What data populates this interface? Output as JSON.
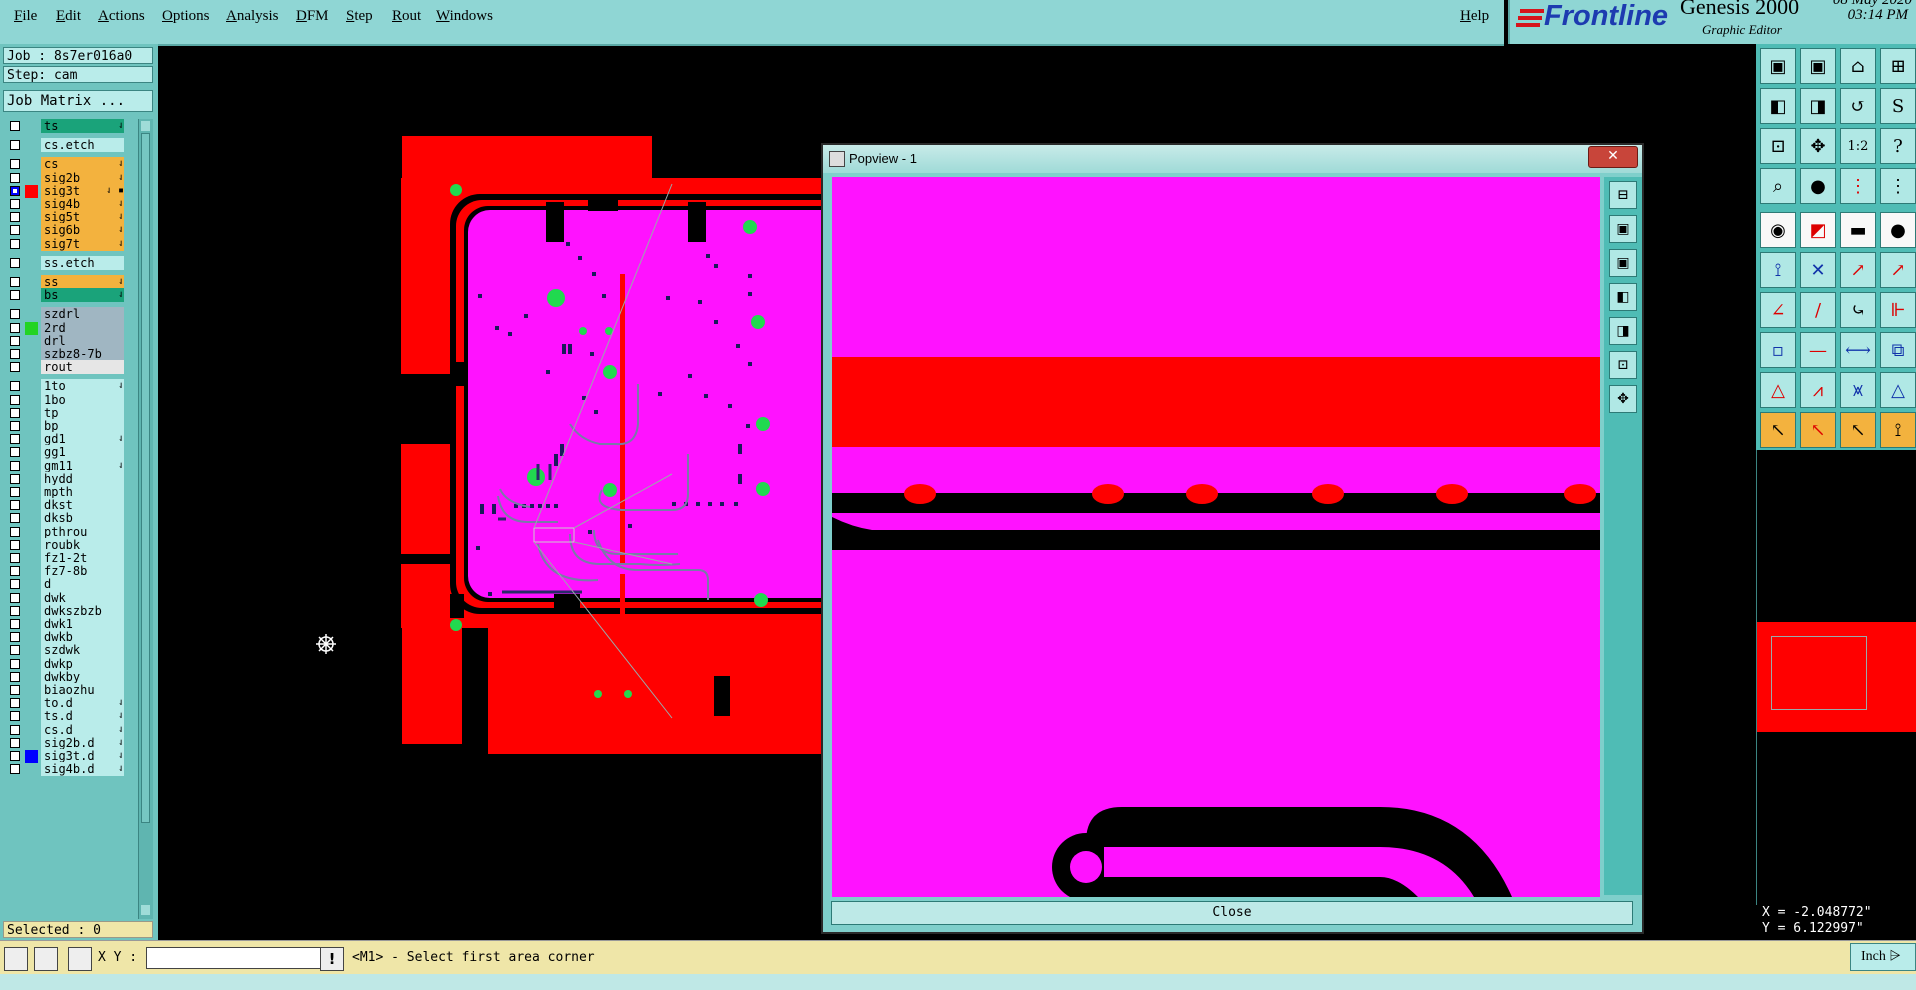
{
  "menubar": {
    "items": [
      "File",
      "Edit",
      "Actions",
      "Options",
      "Analysis",
      "DFM",
      "Step",
      "Rout",
      "Windows"
    ],
    "help": "Help"
  },
  "brand": {
    "logo": "Frontline",
    "product": "Genesis 2000",
    "subtitle": "Graphic Editor",
    "date": "08 May 2020",
    "time": "03:14 PM"
  },
  "left_panel": {
    "job": "Job : 8s7er016a0",
    "step": "Step: cam",
    "job_matrix": "Job Matrix ...",
    "selected": "Selected : 0"
  },
  "layers": [
    {
      "name": "ts",
      "color": "#1aa37a",
      "flag": "⇃"
    },
    {
      "name": "cs.etch",
      "color": "#b9ecea",
      "flag": ""
    },
    {
      "name": "cs",
      "color": "#f3b23e",
      "flag": "⇃"
    },
    {
      "name": "sig2b",
      "color": "#f3b23e",
      "flag": "⇃"
    },
    {
      "name": "sig3t",
      "color": "#f3b23e",
      "flag": "⇃ ▪",
      "mark": "#ff0000",
      "active": true
    },
    {
      "name": "sig4b",
      "color": "#f3b23e",
      "flag": "⇃"
    },
    {
      "name": "sig5t",
      "color": "#f3b23e",
      "flag": "⇃"
    },
    {
      "name": "sig6b",
      "color": "#f3b23e",
      "flag": "⇃"
    },
    {
      "name": "sig7t",
      "color": "#f3b23e",
      "flag": "⇃"
    },
    {
      "name": "ss.etch",
      "color": "#b9ecea",
      "flag": ""
    },
    {
      "name": "ss",
      "color": "#f3b23e",
      "flag": "⇃"
    },
    {
      "name": "bs",
      "color": "#1aa37a",
      "flag": "⇃"
    },
    {
      "name": "szdrl",
      "color": "#a0b6c2",
      "flag": ""
    },
    {
      "name": "2rd",
      "color": "#a0b6c2",
      "flag": "",
      "mark": "#23d423"
    },
    {
      "name": "drl",
      "color": "#a0b6c2",
      "flag": ""
    },
    {
      "name": "szbz8-7b",
      "color": "#a0b6c2",
      "flag": ""
    },
    {
      "name": "rout",
      "color": "#e6e6e6",
      "flag": ""
    },
    {
      "name": "1to",
      "color": "#b9ecea",
      "flag": "⇃"
    },
    {
      "name": "1bo",
      "color": "#b9ecea",
      "flag": ""
    },
    {
      "name": "tp",
      "color": "#b9ecea",
      "flag": ""
    },
    {
      "name": "bp",
      "color": "#b9ecea",
      "flag": ""
    },
    {
      "name": "gd1",
      "color": "#b9ecea",
      "flag": "⇃"
    },
    {
      "name": "gg1",
      "color": "#b9ecea",
      "flag": ""
    },
    {
      "name": "gm11",
      "color": "#b9ecea",
      "flag": "⇃"
    },
    {
      "name": "hydd",
      "color": "#b9ecea",
      "flag": ""
    },
    {
      "name": "mpth",
      "color": "#b9ecea",
      "flag": ""
    },
    {
      "name": "dkst",
      "color": "#b9ecea",
      "flag": ""
    },
    {
      "name": "dksb",
      "color": "#b9ecea",
      "flag": ""
    },
    {
      "name": "pthrou",
      "color": "#b9ecea",
      "flag": ""
    },
    {
      "name": "roubk",
      "color": "#b9ecea",
      "flag": ""
    },
    {
      "name": "fz1-2t",
      "color": "#b9ecea",
      "flag": ""
    },
    {
      "name": "fz7-8b",
      "color": "#b9ecea",
      "flag": ""
    },
    {
      "name": "d",
      "color": "#b9ecea",
      "flag": ""
    },
    {
      "name": "dwk",
      "color": "#b9ecea",
      "flag": ""
    },
    {
      "name": "dwkszbzb",
      "color": "#b9ecea",
      "flag": ""
    },
    {
      "name": "dwk1",
      "color": "#b9ecea",
      "flag": ""
    },
    {
      "name": "dwkb",
      "color": "#b9ecea",
      "flag": ""
    },
    {
      "name": "szdwk",
      "color": "#b9ecea",
      "flag": ""
    },
    {
      "name": "dwkp",
      "color": "#b9ecea",
      "flag": ""
    },
    {
      "name": "dwkby",
      "color": "#b9ecea",
      "flag": ""
    },
    {
      "name": "biaozhu",
      "color": "#b9ecea",
      "flag": ""
    },
    {
      "name": "to.d",
      "color": "#b9ecea",
      "flag": "⇃"
    },
    {
      "name": "ts.d",
      "color": "#b9ecea",
      "flag": "⇃"
    },
    {
      "name": "cs.d",
      "color": "#b9ecea",
      "flag": "⇃"
    },
    {
      "name": "sig2b.d",
      "color": "#b9ecea",
      "flag": "⇃"
    },
    {
      "name": "sig3t.d",
      "color": "#b9ecea",
      "flag": "⇃",
      "mark": "#0000ff"
    },
    {
      "name": "sig4b.d",
      "color": "#b9ecea",
      "flag": "⇃"
    }
  ],
  "popview": {
    "title": "Popview - 1",
    "close_x": "✕",
    "close_label": "Close"
  },
  "status": {
    "xy_label": "X Y :",
    "xy_value": "",
    "message": "<M1> - Select first area corner",
    "units": "Inch"
  },
  "coords": {
    "x": "X = -2.048772\"",
    "y": "Y = 6.122997\""
  },
  "colors": {
    "magenta": "#ff12ff",
    "red": "#ff0000",
    "pad_green": "#21d94f",
    "panel_teal": "#8fd6d4"
  }
}
